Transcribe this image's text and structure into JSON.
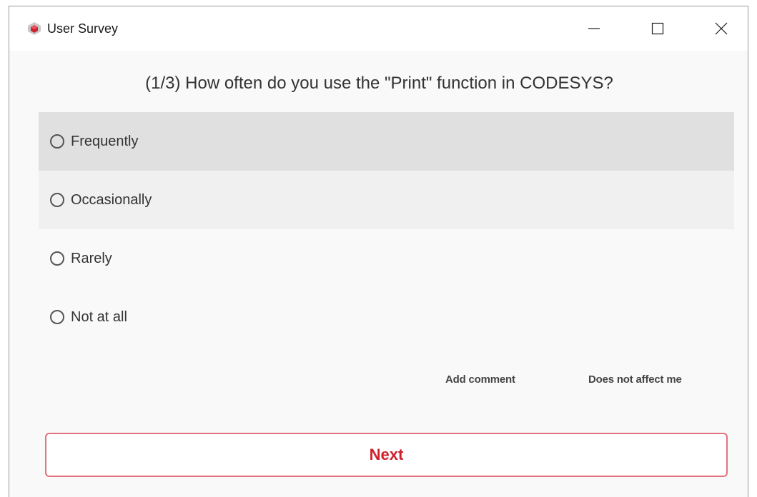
{
  "window": {
    "title": "User Survey",
    "accent_color": "#d0202e"
  },
  "survey": {
    "question": "(1/3) How often do you use the \"Print\" function in CODESYS?",
    "options": [
      {
        "label": "Frequently",
        "selected": false
      },
      {
        "label": "Occasionally",
        "selected": false
      },
      {
        "label": "Rarely",
        "selected": false
      },
      {
        "label": "Not at all",
        "selected": false
      }
    ],
    "add_comment_label": "Add comment",
    "does_not_affect_label": "Does not affect me",
    "next_label": "Next"
  },
  "icons": {
    "app": "codesys-cube-icon",
    "minimize": "minimize-icon",
    "maximize": "maximize-icon",
    "close": "close-icon"
  }
}
